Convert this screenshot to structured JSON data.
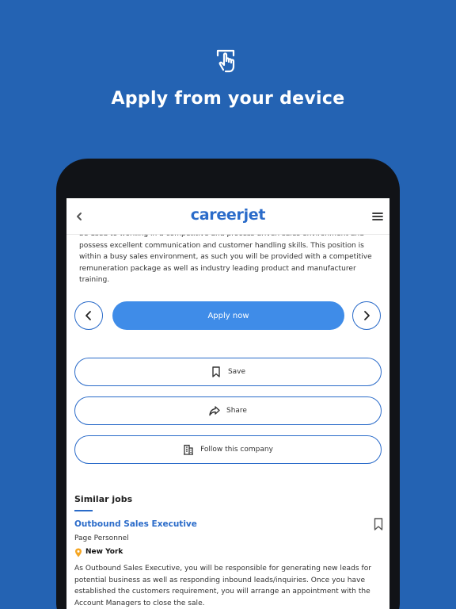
{
  "hero": {
    "title": "Apply from your device",
    "icon": "touch-hand-icon"
  },
  "app": {
    "logo": "careerjet",
    "back_icon": "chevron-left-icon",
    "menu_icon": "hamburger-menu-icon"
  },
  "job_description": "be used to working in a competitive and process driven sales environment and possess excellent communication and customer handling skills. This position is within a busy sales environment, as such you will be provided with a competitive remuneration package as well as industry leading product and manufacturer training.",
  "actions": {
    "apply_label": "Apply now",
    "save_label": "Save",
    "share_label": "Share",
    "follow_label": "Follow this company"
  },
  "similar": {
    "heading": "Similar jobs",
    "jobs": [
      {
        "title": "Outbound Sales Executive",
        "company": "Page Personnel",
        "location": "New York",
        "description": "As Outbound Sales Executive, you will be responsible for generating new leads for potential business as well as responding inbound leads/inquiries. Once you have established the customers requirement, you will arrange an appointment with the Account Managers to close the sale."
      }
    ]
  },
  "colors": {
    "background": "#2463b3",
    "accent": "#2a6bc9",
    "apply_button": "#3f8ce8",
    "location_pin": "#f5a623"
  }
}
